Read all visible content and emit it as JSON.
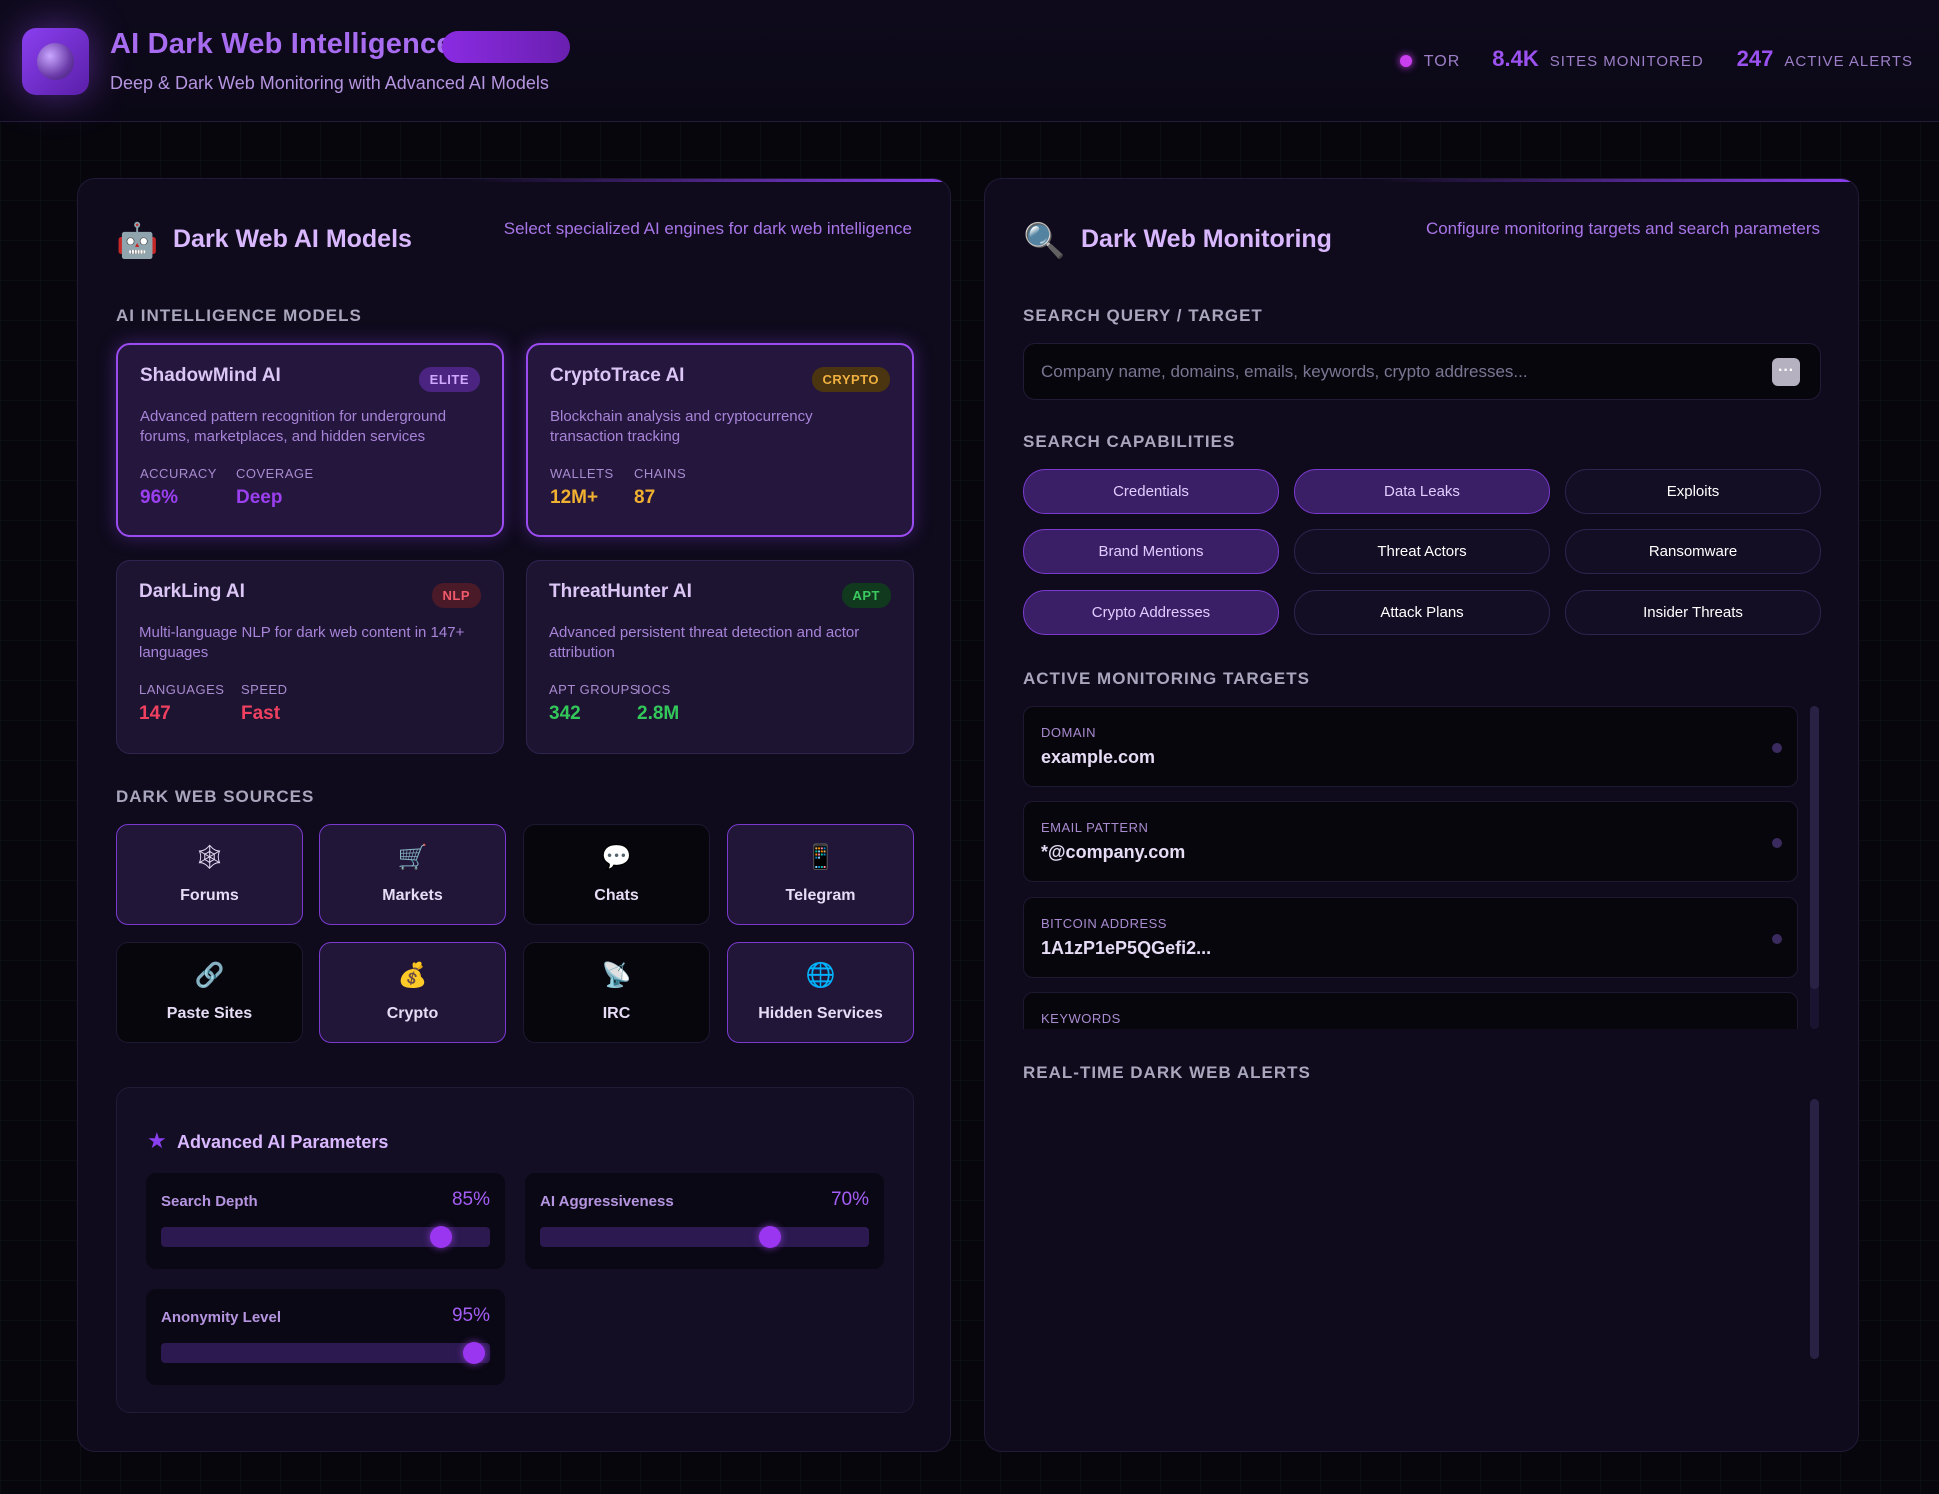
{
  "header": {
    "title": "AI Dark Web Intelligence",
    "subtitle": "Deep & Dark Web Monitoring with Advanced AI Models",
    "tor_label": "TOR",
    "sites_count": "8.4K",
    "sites_label": "SITES MONITORED",
    "alerts_count": "247",
    "alerts_label": "ACTIVE ALERTS",
    "logo_icon": "globe-icon"
  },
  "left": {
    "title": "Dark Web AI Models",
    "desc": "Select specialized AI engines for dark web intelligence",
    "icon": "robot-icon",
    "models_label": "AI INTELLIGENCE MODELS",
    "models": [
      {
        "name": "ShadowMind AI",
        "badge": "ELITE",
        "desc": "Advanced pattern recognition for underground forums, marketplaces, and hidden services",
        "m1_label": "ACCURACY",
        "m1_value": "96%",
        "m2_label": "COVERAGE",
        "m2_value": "Deep",
        "color": "#9b3ff0"
      },
      {
        "name": "CryptoTrace AI",
        "badge": "CRYPTO",
        "desc": "Blockchain analysis and cryptocurrency transaction tracking",
        "m1_label": "WALLETS",
        "m1_value": "12M+",
        "m2_label": "CHAINS",
        "m2_value": "87",
        "color": "#f0b030"
      },
      {
        "name": "DarkLing AI",
        "badge": "NLP",
        "desc": "Multi-language NLP for dark web content in 147+ languages",
        "m1_label": "LANGUAGES",
        "m1_value": "147",
        "m2_label": "SPEED",
        "m2_value": "Fast",
        "color": "#f04060"
      },
      {
        "name": "ThreatHunter AI",
        "badge": "APT",
        "desc": "Advanced persistent threat detection and actor attribution",
        "m1_label": "APT GROUPS",
        "m1_value": "342",
        "m2_label": "IOCS",
        "m2_value": "2.8M",
        "color": "#33c85a"
      }
    ],
    "sources_label": "DARK WEB SOURCES",
    "sources": [
      {
        "label": "Forums",
        "icon": "spider-web-icon",
        "glyph": "🕸"
      },
      {
        "label": "Markets",
        "icon": "shopping-cart-icon",
        "glyph": "🛒"
      },
      {
        "label": "Chats",
        "icon": "chat-bubble-icon",
        "glyph": "💬"
      },
      {
        "label": "Telegram",
        "icon": "mobile-phone-icon",
        "glyph": "📱"
      },
      {
        "label": "Paste Sites",
        "icon": "link-icon",
        "glyph": "🔗"
      },
      {
        "label": "Crypto",
        "icon": "money-bag-icon",
        "glyph": "💰"
      },
      {
        "label": "IRC",
        "icon": "satellite-dish-icon",
        "glyph": "📡"
      },
      {
        "label": "Hidden Services",
        "icon": "globe-icon",
        "glyph": "🌐"
      }
    ],
    "params": {
      "title": "Advanced AI Parameters",
      "icon": "star-icon",
      "sliders": [
        {
          "label": "Search Depth",
          "value": "85%",
          "fraction": 0.85
        },
        {
          "label": "AI Aggressiveness",
          "value": "70%",
          "fraction": 0.7
        },
        {
          "label": "Anonymity Level",
          "value": "95%",
          "fraction": 0.95
        }
      ]
    }
  },
  "right": {
    "title": "Dark Web Monitoring",
    "desc": "Configure monitoring targets and search parameters",
    "icon": "magnifier-icon",
    "query_label": "SEARCH QUERY / TARGET",
    "query_placeholder": "Company name, domains, emails, keywords, crypto addresses...",
    "query_value": "",
    "search_button": "···",
    "capabilities_label": "SEARCH CAPABILITIES",
    "capabilities": [
      {
        "label": "Credentials",
        "active": true
      },
      {
        "label": "Data Leaks",
        "active": true
      },
      {
        "label": "Exploits",
        "active": false
      },
      {
        "label": "Brand Mentions",
        "active": true
      },
      {
        "label": "Threat Actors",
        "active": false
      },
      {
        "label": "Ransomware",
        "active": false
      },
      {
        "label": "Crypto Addresses",
        "active": true
      },
      {
        "label": "Attack Plans",
        "active": false
      },
      {
        "label": "Insider Threats",
        "active": false
      }
    ],
    "targets_label": "ACTIVE MONITORING TARGETS",
    "targets": [
      {
        "type": "DOMAIN",
        "value": "example.com"
      },
      {
        "type": "EMAIL PATTERN",
        "value": "*@company.com"
      },
      {
        "type": "BITCOIN ADDRESS",
        "value": "1A1zP1eP5QGefi2..."
      },
      {
        "type": "KEYWORDS",
        "value": ""
      }
    ],
    "alerts_label": "REAL-TIME DARK WEB ALERTS"
  }
}
